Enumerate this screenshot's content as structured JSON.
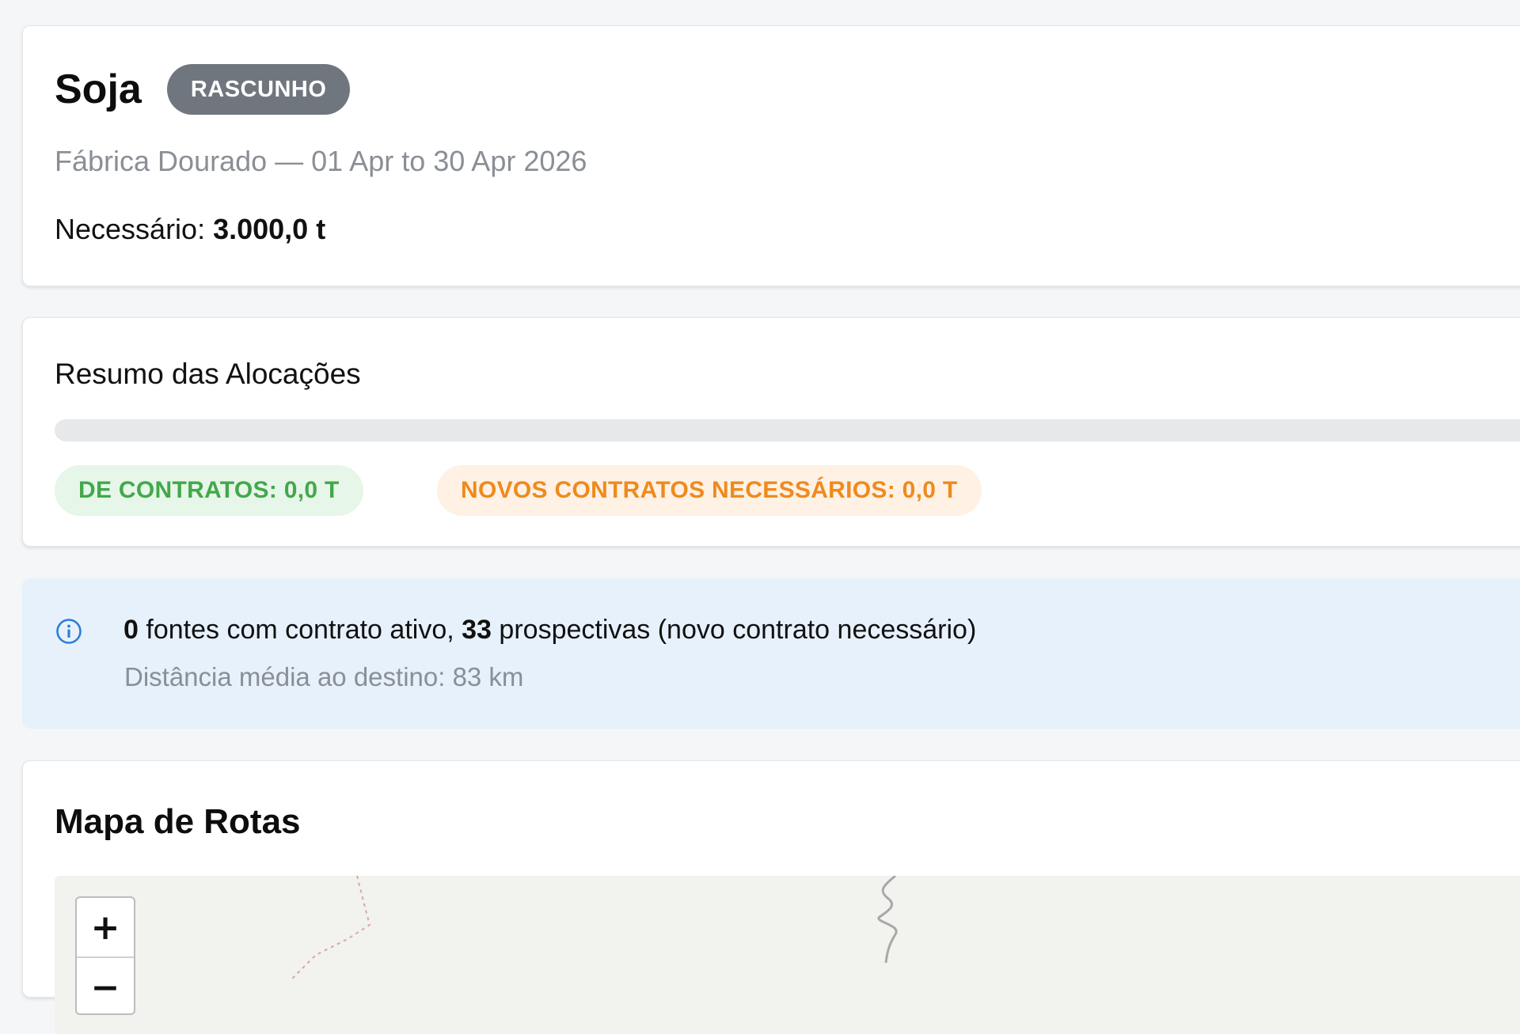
{
  "header": {
    "title": "Soja",
    "status_badge": "RASCUNHO",
    "subtitle": "Fábrica Dourado — 01 Apr to 30 Apr 2026",
    "required_label": "Necessário:",
    "required_value": "3.000,0 t"
  },
  "summary": {
    "title": "Resumo das Alocações",
    "progress_fraction": 0,
    "from_contracts": "DE CONTRATOS: 0,0 T",
    "new_contracts": "NOVOS CONTRATOS NECESSÁRIOS: 0,0 T"
  },
  "info": {
    "active_count": "0",
    "active_text": "fontes com contrato ativo,",
    "prospective_count": "33",
    "prospective_text": "prospectivas (novo contrato necessário)",
    "average_distance": "Distância média ao destino: 83 km",
    "icon": "info-icon"
  },
  "map": {
    "title": "Mapa de Rotas",
    "zoom_in_label": "+",
    "zoom_out_label": "−"
  },
  "colors": {
    "draft_badge": "#6f767e",
    "green_chip_text": "#43a84a",
    "orange_chip_text": "#ef8a1d",
    "info_bg": "#e6f1fb",
    "info_icon": "#2e7dd6"
  }
}
